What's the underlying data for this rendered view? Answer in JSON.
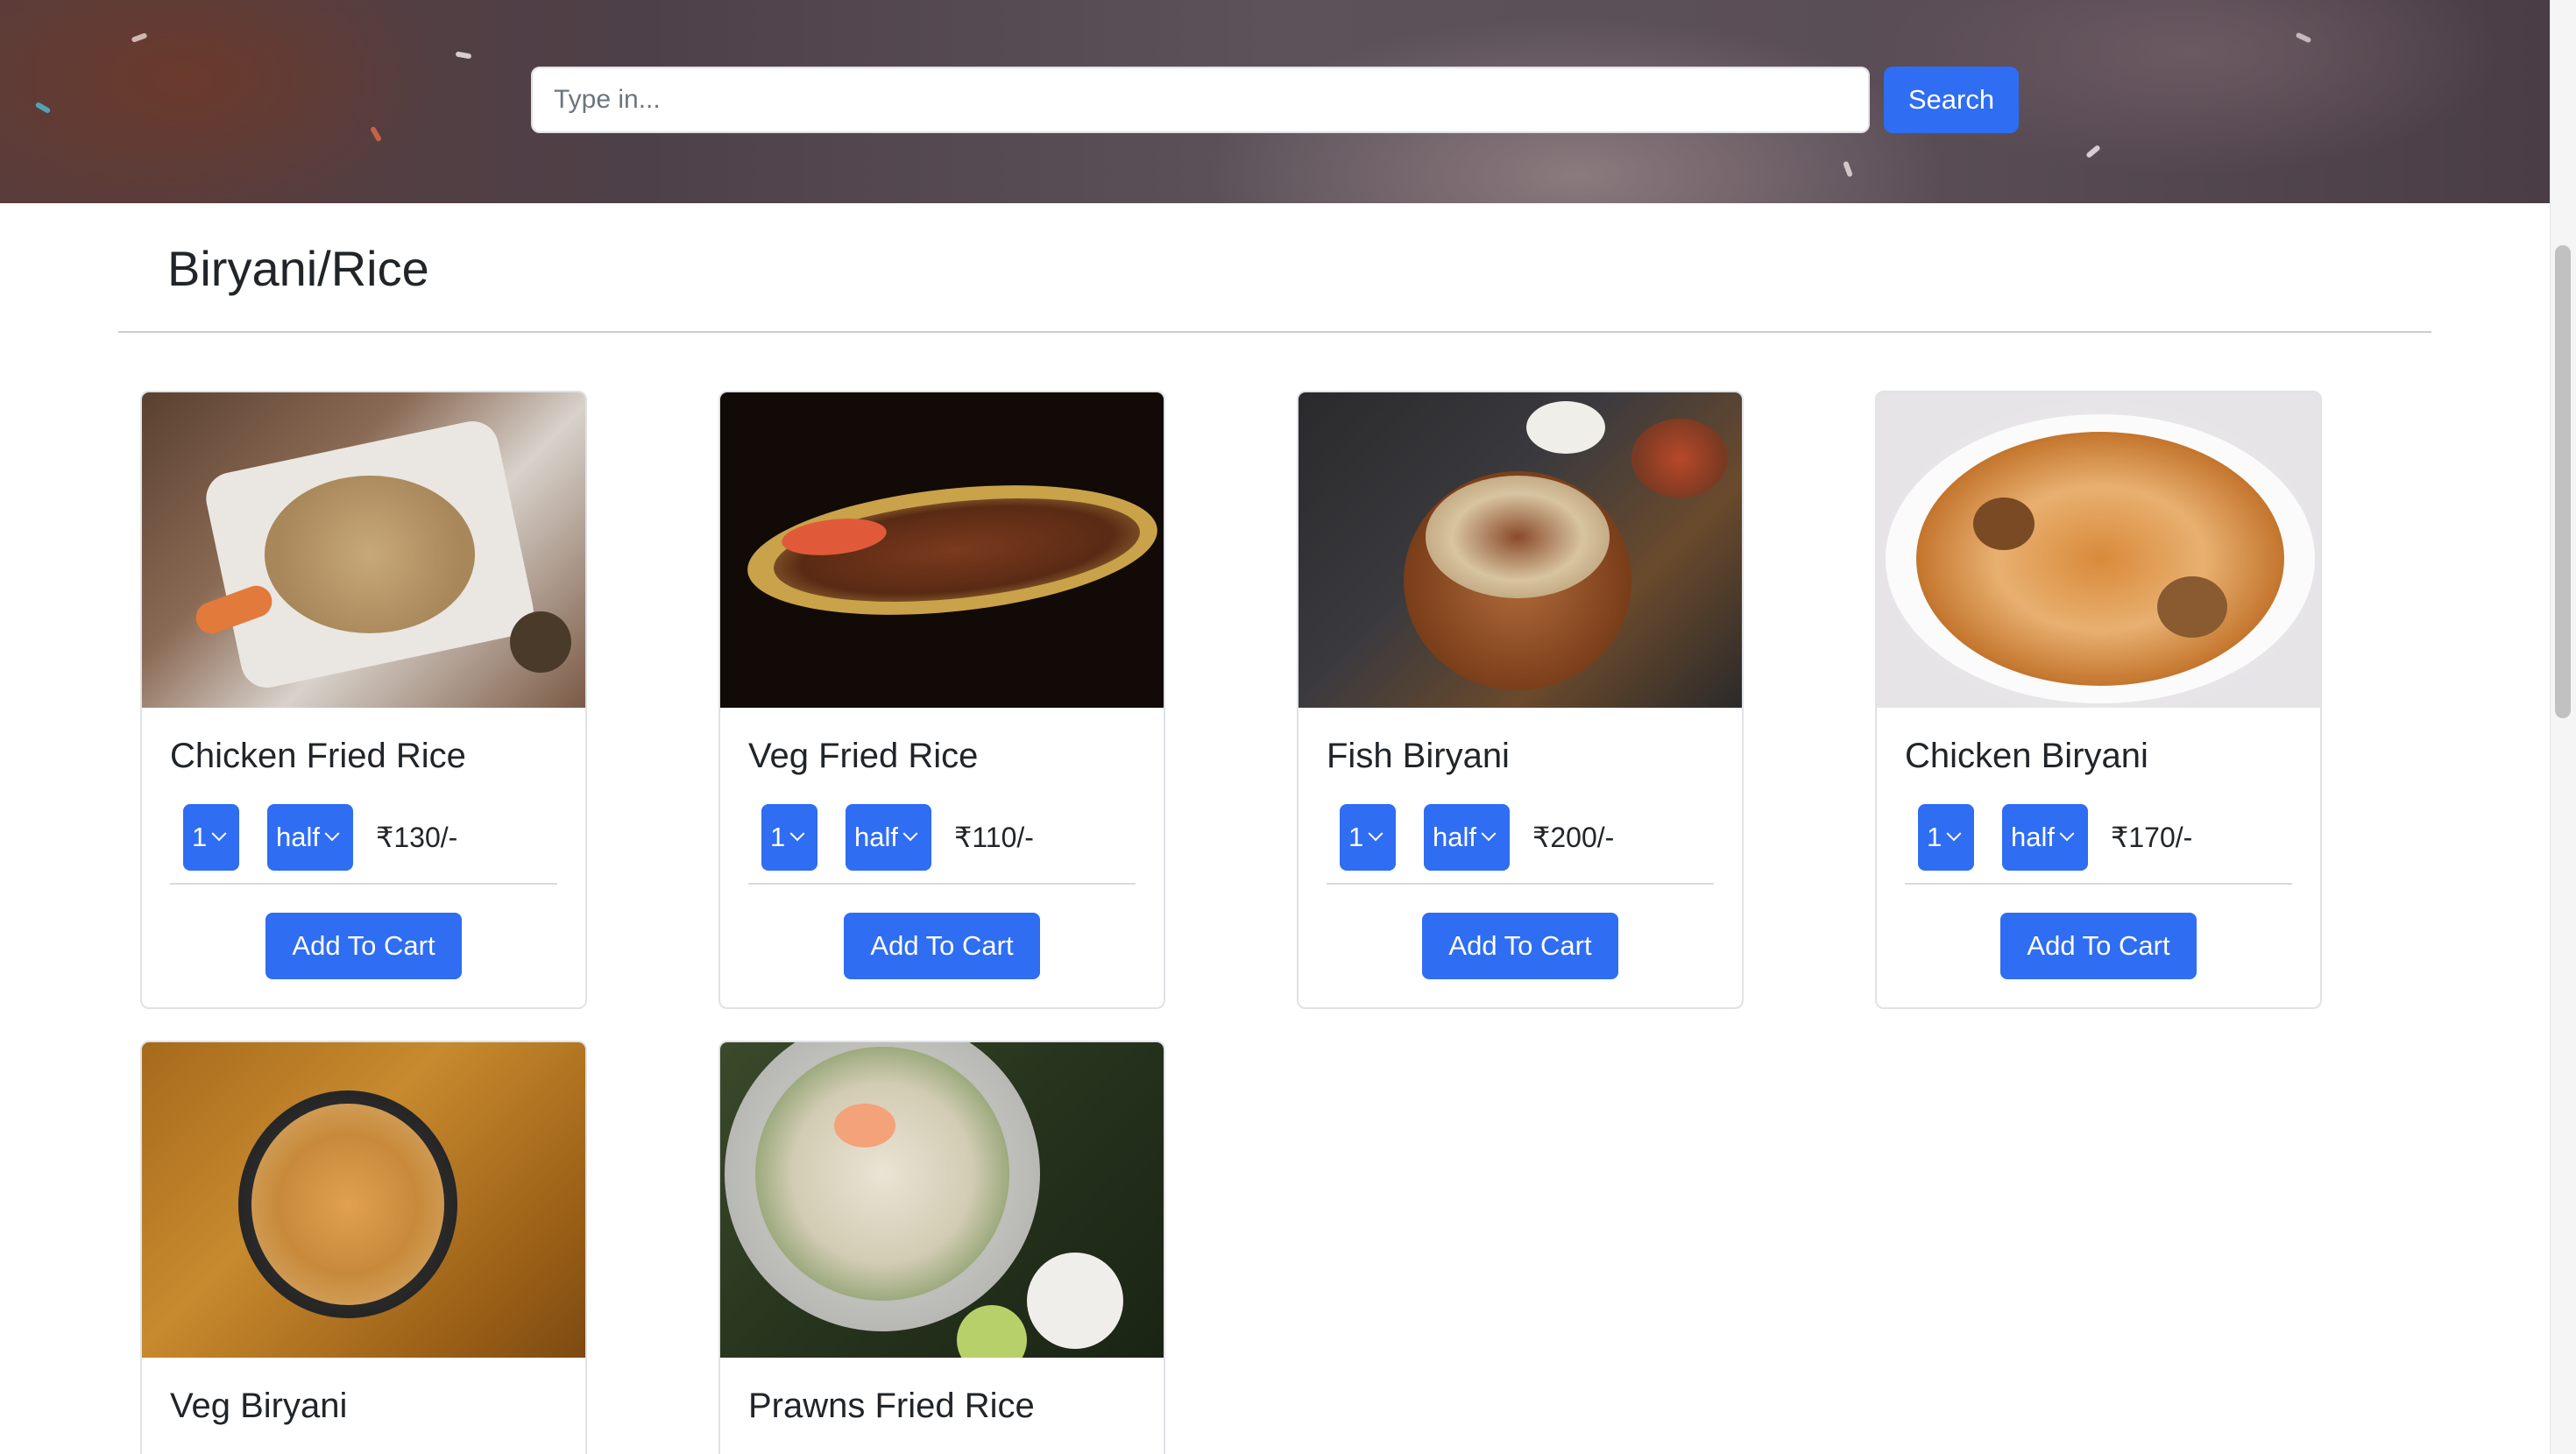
{
  "search": {
    "placeholder": "Type in...",
    "value": "",
    "button_label": "Search"
  },
  "category": {
    "title": "Biryani/Rice"
  },
  "items": [
    {
      "name": "Chicken Fried Rice",
      "qty": "1",
      "size": "half",
      "price": "₹130/-",
      "button_label": "Add To Cart"
    },
    {
      "name": "Veg Fried Rice",
      "qty": "1",
      "size": "half",
      "price": "₹110/-",
      "button_label": "Add To Cart"
    },
    {
      "name": "Fish Biryani",
      "qty": "1",
      "size": "half",
      "price": "₹200/-",
      "button_label": "Add To Cart"
    },
    {
      "name": "Chicken Biryani",
      "qty": "1",
      "size": "half",
      "price": "₹170/-",
      "button_label": "Add To Cart"
    },
    {
      "name": "Veg Biryani"
    },
    {
      "name": "Prawns Fried Rice"
    }
  ],
  "colors": {
    "primary": "#2f6df2",
    "text": "#212529",
    "border": "#dfe2e6"
  },
  "icons": {
    "select_arrow": "chevron-down-icon"
  }
}
